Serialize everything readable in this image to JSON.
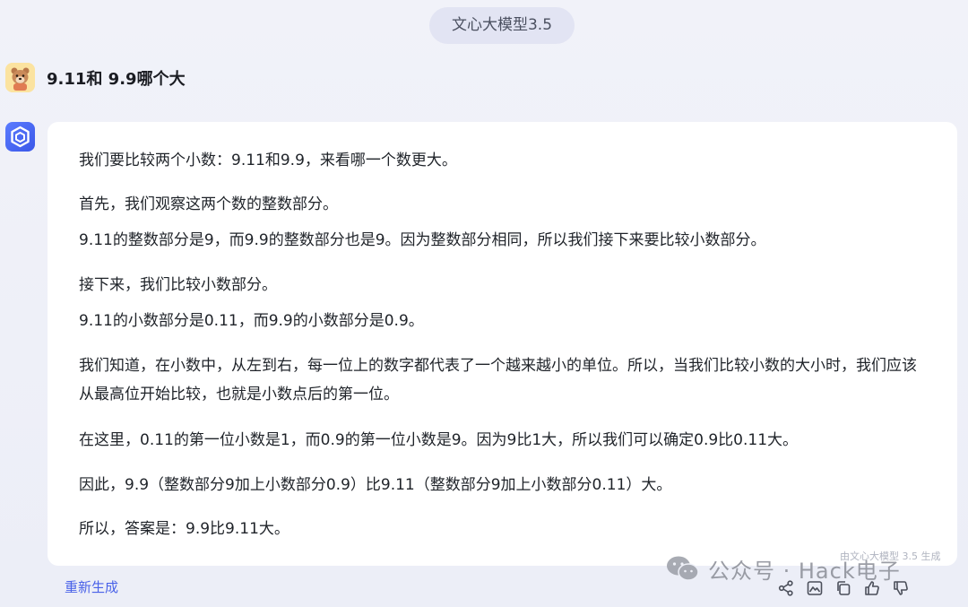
{
  "header": {
    "model_label": "文心大模型3.5"
  },
  "user": {
    "question": "9.11和 9.9哪个大"
  },
  "answer": {
    "paragraphs": [
      "我们要比较两个小数：9.11和9.9，来看哪一个数更大。",
      "首先，我们观察这两个数的整数部分。",
      "9.11的整数部分是9，而9.9的整数部分也是9。因为整数部分相同，所以我们接下来要比较小数部分。",
      "接下来，我们比较小数部分。",
      "9.11的小数部分是0.11，而9.9的小数部分是0.9。",
      "我们知道，在小数中，从左到右，每一位上的数字都代表了一个越来越小的单位。所以，当我们比较小数的大小时，我们应该从最高位开始比较，也就是小数点后的第一位。",
      "在这里，0.11的第一位小数是1，而0.9的第一位小数是9。因为9比1大，所以我们可以确定0.9比0.11大。",
      "因此，9.9（整数部分9加上小数部分0.9）比9.11（整数部分9加上小数部分0.11）大。",
      "所以，答案是：9.9比9.11大。"
    ],
    "generated_note": "由文心大模型 3.5 生成"
  },
  "footer": {
    "regenerate_label": "重新生成",
    "watermark": "公众号 · Hack电子",
    "icons": [
      "share-icon",
      "image-icon",
      "copy-icon",
      "thumbs-up-icon",
      "thumbs-down-icon"
    ]
  },
  "colors": {
    "accent": "#4a62e8",
    "background": "#eef0f8",
    "card": "#ffffff"
  }
}
